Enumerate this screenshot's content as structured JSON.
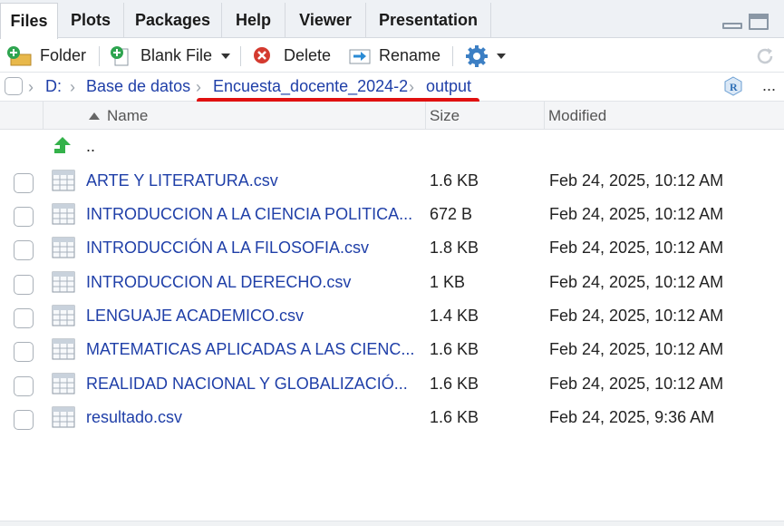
{
  "tabs": [
    {
      "label": "Files",
      "active": true
    },
    {
      "label": "Plots"
    },
    {
      "label": "Packages"
    },
    {
      "label": "Help"
    },
    {
      "label": "Viewer"
    },
    {
      "label": "Presentation"
    }
  ],
  "toolbar": {
    "new_folder_label": "Folder",
    "blank_file_label": "Blank File",
    "delete_label": "Delete",
    "rename_label": "Rename"
  },
  "breadcrumb": {
    "items": [
      "D:",
      "Base de datos",
      "Encuesta_docente_2024-2",
      "output"
    ],
    "more_label": "..."
  },
  "columns": {
    "name": "Name",
    "size": "Size",
    "modified": "Modified"
  },
  "parent_dir_label": "..",
  "files": [
    {
      "name": "ARTE Y LITERATURA.csv",
      "size": "1.6 KB",
      "modified": "Feb 24, 2025, 10:12 AM"
    },
    {
      "name": "INTRODUCCION A LA CIENCIA POLITICA...",
      "size": "672 B",
      "modified": "Feb 24, 2025, 10:12 AM"
    },
    {
      "name": "INTRODUCCIÓN A LA FILOSOFIA.csv",
      "size": "1.8 KB",
      "modified": "Feb 24, 2025, 10:12 AM"
    },
    {
      "name": "INTRODUCCION AL DERECHO.csv",
      "size": "1 KB",
      "modified": "Feb 24, 2025, 10:12 AM"
    },
    {
      "name": "LENGUAJE ACADEMICO.csv",
      "size": "1.4 KB",
      "modified": "Feb 24, 2025, 10:12 AM"
    },
    {
      "name": "MATEMATICAS APLICADAS A LAS CIENC...",
      "size": "1.6 KB",
      "modified": "Feb 24, 2025, 10:12 AM"
    },
    {
      "name": "REALIDAD NACIONAL Y GLOBALIZACIÓ...",
      "size": "1.6 KB",
      "modified": "Feb 24, 2025, 10:12 AM"
    },
    {
      "name": "resultado.csv",
      "size": "1.6 KB",
      "modified": "Feb 24, 2025, 9:36 AM"
    }
  ],
  "colors": {
    "link": "#1f3fa8",
    "annotation_underline": "#e01010",
    "tabbar_bg": "#eef1f5"
  }
}
